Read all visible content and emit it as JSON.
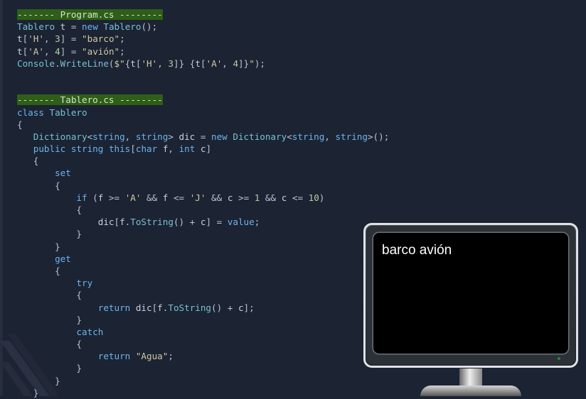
{
  "program": {
    "header": "------- Program.cs --------",
    "lines": [
      "Tablero t = new Tablero();",
      "t['H', 3] = \"barco\";",
      "t['A', 4] = \"avión\";",
      "Console.WriteLine($\"{t['H', 3]} {t['A', 4]}\");"
    ]
  },
  "tablero": {
    "header": "------- Tablero.cs --------",
    "lines": [
      "class Tablero",
      "{",
      "   Dictionary<string, string> dic = new Dictionary<string, string>();",
      "   public string this[char f, int c]",
      "   {",
      "       set",
      "       {",
      "           if (f >= 'A' && f <= 'J' && c >= 1 && c <= 10)",
      "           {",
      "               dic[f.ToString() + c] = value;",
      "           }",
      "       }",
      "       get",
      "       {",
      "           try",
      "           {",
      "               return dic[f.ToString() + c];",
      "           }",
      "           catch",
      "           {",
      "               return \"Agua\";",
      "           }",
      "       }",
      "   }"
    ]
  },
  "console_output": "barco avión",
  "colors": {
    "background": "#1c2333",
    "header_highlight": "#2e5e18",
    "keyword": "#6cb4ee",
    "string": "#cfc9a2",
    "number": "#b5cea8"
  },
  "icons": [
    "monitor-icon",
    "power-led-icon"
  ]
}
